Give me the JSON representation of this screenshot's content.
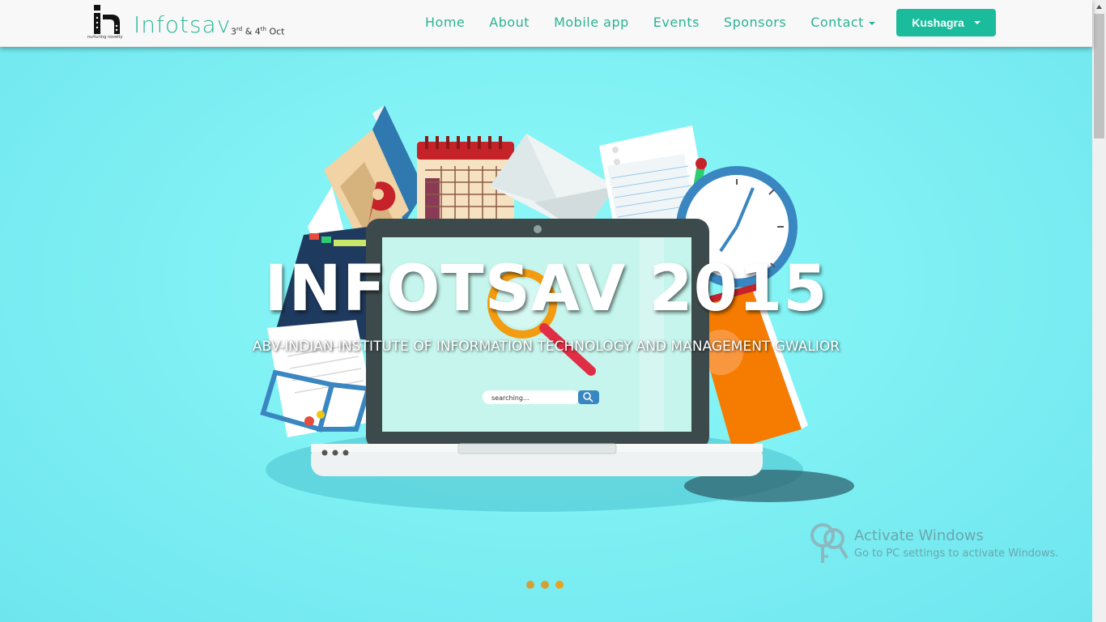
{
  "navbar": {
    "brand": "Infotsav",
    "brand_date_1": "3",
    "brand_date_1_sup": "rd",
    "brand_date_2": " & 4",
    "brand_date_2_sup": "th",
    "brand_date_3": " Oct",
    "logo_tagline": "nurturing novelty",
    "items": [
      {
        "label": "Home"
      },
      {
        "label": "About"
      },
      {
        "label": "Mobile app"
      },
      {
        "label": "Events"
      },
      {
        "label": "Sponsors"
      },
      {
        "label": "Contact"
      }
    ],
    "user_button": "Kushagra"
  },
  "hero": {
    "title": "INFOTSAV 2015",
    "subtitle": "ABV-INDIAN INSTITUTE OF INFORMATION TECHNOLOGY AND MANAGEMENT GWALIOR",
    "search_placeholder": "searching...",
    "carousel_count": 3,
    "active_slide": 3
  },
  "watermark": {
    "title": "Activate Windows",
    "subtitle": "Go to PC settings to activate Windows."
  },
  "colors": {
    "accent": "#1abc9c",
    "nav_text": "#2ab396",
    "hero_bg": "#80f1f4",
    "dot": "#e8a21c"
  }
}
